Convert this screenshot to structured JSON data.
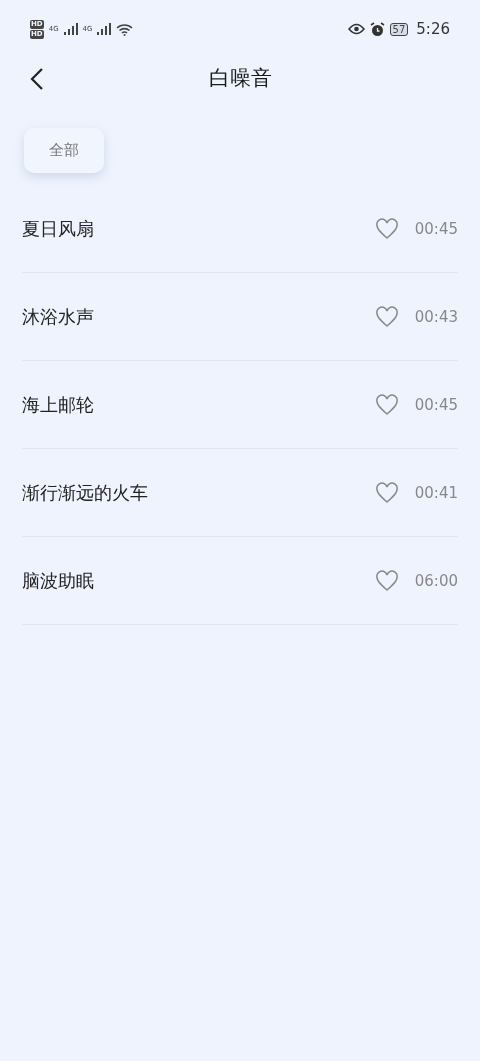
{
  "status_bar": {
    "sims": [
      {
        "badge": "HD",
        "network": "4G"
      },
      {
        "badge": "HD",
        "network": "4G"
      }
    ],
    "battery": "57",
    "time": "5:26"
  },
  "header": {
    "title": "白噪音"
  },
  "tabs": [
    {
      "label": "全部",
      "selected": true
    }
  ],
  "tracks": [
    {
      "name": "夏日风扇",
      "favorite": false,
      "duration": "00:45"
    },
    {
      "name": "沐浴水声",
      "favorite": false,
      "duration": "00:43"
    },
    {
      "name": "海上邮轮",
      "favorite": false,
      "duration": "00:45"
    },
    {
      "name": "渐行渐远的火车",
      "favorite": false,
      "duration": "00:41"
    },
    {
      "name": "脑波助眠",
      "favorite": false,
      "duration": "06:00"
    }
  ]
}
